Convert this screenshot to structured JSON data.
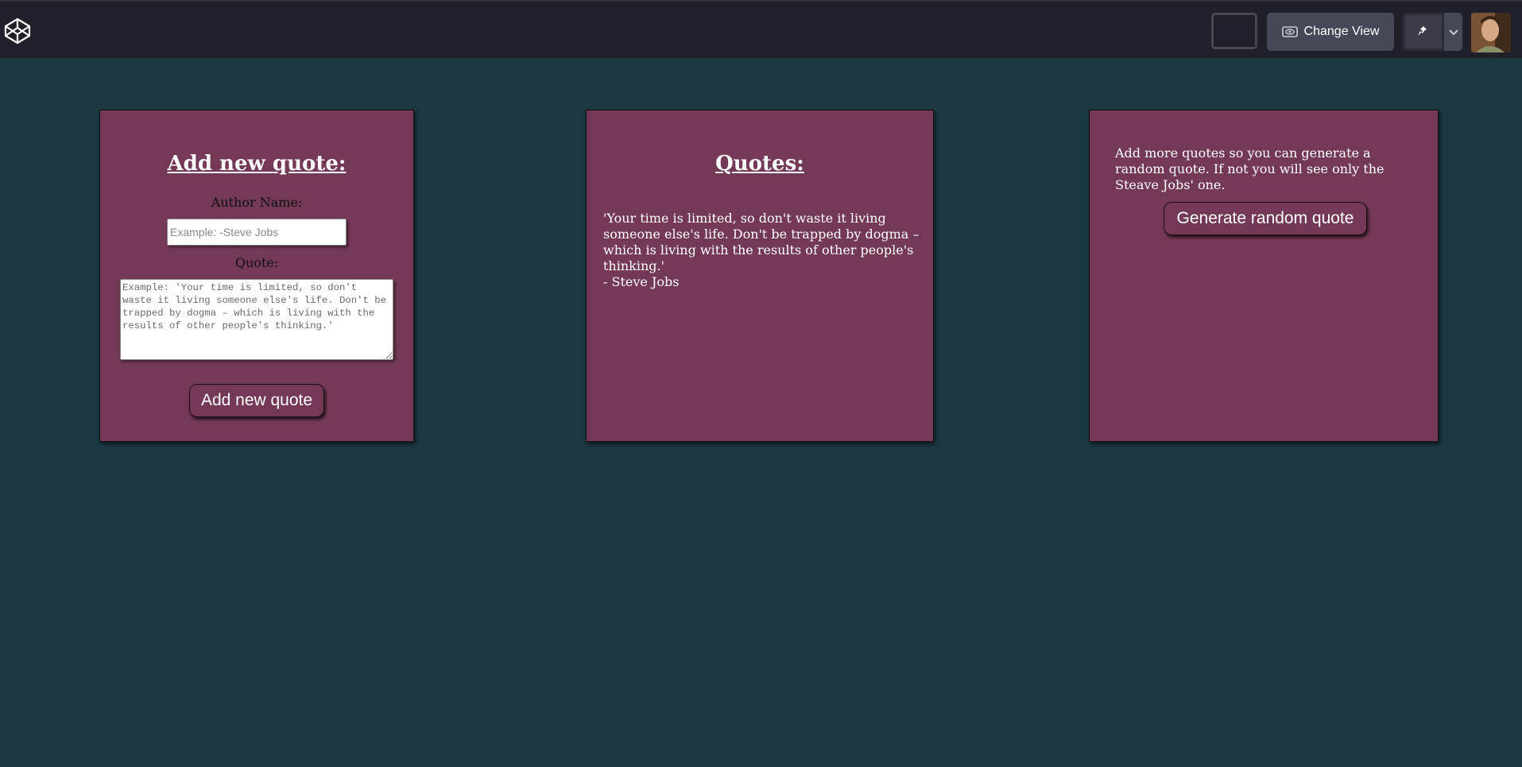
{
  "topbar": {
    "logo_icon": "codepen-cube-icon",
    "change_view_label": "Change View",
    "change_view_icon": "eye-icon",
    "pin_icon": "pin-icon",
    "dropdown_icon": "chevron-down-icon",
    "avatar_icon": "user-avatar"
  },
  "add_card": {
    "title": "Add new quote:",
    "author_label": "Author Name:",
    "author_placeholder": "Example: -Steve Jobs",
    "quote_label": "Quote:",
    "quote_placeholder": "Example: 'Your time is limited, so don't waste it living someone else's life. Don't be trapped by dogma – which is living with the results of other people's thinking.'",
    "button_label": "Add new quote"
  },
  "quotes_card": {
    "title": "Quotes:",
    "quote_text": "'Your time is limited, so don't waste it living someone else's life. Don't be trapped by dogma – which is living with the results of other people's thinking.'",
    "quote_author": "- Steve Jobs"
  },
  "random_card": {
    "info_text": "Add more quotes so you can generate a random quote. If not you will see only the Steave Jobs' one.",
    "button_label": "Generate random quote"
  },
  "colors": {
    "page_background": "#1c3942",
    "topbar_background": "#1f2029",
    "card_background": "#743957",
    "button_gray": "#444857"
  }
}
